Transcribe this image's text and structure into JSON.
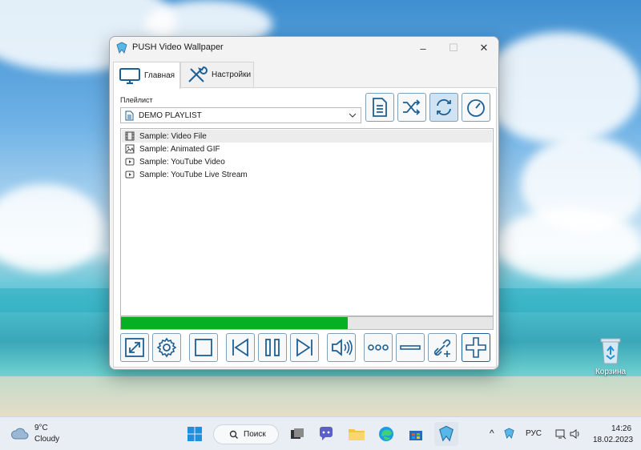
{
  "window": {
    "title": "PUSH Video Wallpaper",
    "tabs": [
      {
        "label": "Главная",
        "icon": "monitor-icon",
        "active": true
      },
      {
        "label": "Настройки",
        "icon": "tools-icon",
        "active": false
      }
    ],
    "playlist_label": "Плейлист",
    "playlist_selected": "DEMO PLAYLIST",
    "top_buttons": [
      "playlist-doc-icon",
      "shuffle-icon",
      "repeat-icon",
      "timer-icon"
    ],
    "items": [
      {
        "label": "Sample: Video File",
        "icon": "film-icon",
        "selected": true
      },
      {
        "label": "Sample: Animated GIF",
        "icon": "image-icon",
        "selected": false
      },
      {
        "label": "Sample: YouTube Video",
        "icon": "play-icon",
        "selected": false
      },
      {
        "label": "Sample: YouTube Live Stream",
        "icon": "play-icon",
        "selected": false
      }
    ],
    "progress_fraction": 0.61,
    "controls": [
      "fullscreen-icon",
      "settings-icon",
      "stop-icon",
      "previous-icon",
      "pause-icon",
      "next-icon",
      "volume-icon",
      "more-icon",
      "remove-icon",
      "add-url-icon",
      "add-icon"
    ]
  },
  "desktop": {
    "recycle_bin_label": "Корзина"
  },
  "taskbar": {
    "weather_temp": "9°C",
    "weather_desc": "Cloudy",
    "search_label": "Поиск",
    "language": "РУС",
    "time": "14:26",
    "date": "18.02.2023"
  },
  "colors": {
    "accent": "#1f5f99",
    "progress": "#06b025",
    "button_border": "#7fa0bb"
  }
}
